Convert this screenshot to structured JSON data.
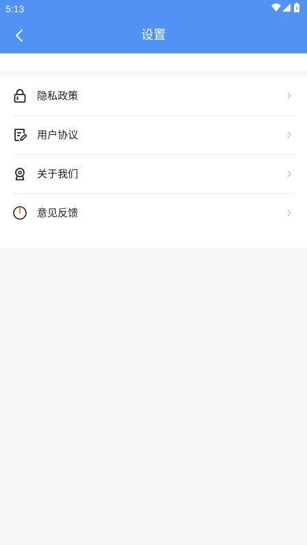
{
  "status_bar": {
    "time": "5:13",
    "icons": [
      "wifi-icon",
      "cell-signal-icon",
      "battery-icon"
    ]
  },
  "header": {
    "title": "设置",
    "back_icon": "chevron-left-icon",
    "background_color": "#5093f3"
  },
  "menu": {
    "items": [
      {
        "label": "隐私政策",
        "icon": "lock-icon"
      },
      {
        "label": "用户协议",
        "icon": "document-edit-icon"
      },
      {
        "label": "关于我们",
        "icon": "info-badge-icon"
      },
      {
        "label": "意见反馈",
        "icon": "power-feedback-icon"
      }
    ],
    "chevron_icon": "chevron-right-icon"
  }
}
